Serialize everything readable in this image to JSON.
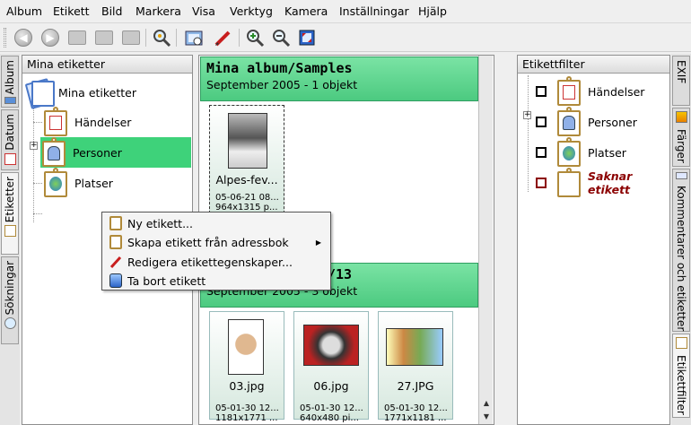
{
  "menubar": {
    "items": [
      "Album",
      "Etikett",
      "Bild",
      "Markera",
      "Visa",
      "Verktyg",
      "Kamera",
      "Inställningar",
      "Hjälp"
    ]
  },
  "toolbar": {
    "icons": [
      "back-icon",
      "forward-icon",
      "album-icon",
      "tags-icon",
      "search-icon",
      "zoom-icon",
      "view-icon",
      "edit-icon",
      "zoom-in-icon",
      "zoom-out-icon",
      "fullscreen-icon"
    ]
  },
  "left_tabs": [
    "Album",
    "Datum",
    "Etiketter",
    "Sökningar"
  ],
  "right_tabs": [
    "EXIF",
    "Färger",
    "Kommentarer och etiketter",
    "Etikettfilter"
  ],
  "tags_panel": {
    "header": "Mina etiketter",
    "root": "Mina etiketter",
    "items": [
      "Händelser",
      "Personer",
      "Platser"
    ],
    "selected": "Personer"
  },
  "album1": {
    "title": "Mina album/Samples",
    "subtitle": "September 2005 - 1 objekt",
    "items": [
      {
        "name": "Alpes-fev...",
        "date": "05-06-21 08...",
        "size": "964x1315 p..."
      }
    ]
  },
  "album2": {
    "title": "/13",
    "subtitle": "September 2005 - 3 objekt",
    "items": [
      {
        "name": "03.jpg",
        "date": "05-01-30 12...",
        "size": "1181x1771 ..."
      },
      {
        "name": "06.jpg",
        "date": "05-01-30 12...",
        "size": "640x480 pi..."
      },
      {
        "name": "27.JPG",
        "date": "05-01-30 12...",
        "size": "1771x1181 ..."
      }
    ]
  },
  "filter_panel": {
    "header": "Etikettfilter",
    "items": [
      "Händelser",
      "Personer",
      "Platser"
    ],
    "missing": "Saknar etikett"
  },
  "context_menu": {
    "items": [
      "Ny etikett...",
      "Skapa etikett från adressbok",
      "Redigera etikettegenskaper...",
      "Ta bort etikett"
    ]
  },
  "colors": {
    "album_header": "#4cca80",
    "selection": "#3ed27a",
    "missing_label": "#8b0000"
  }
}
